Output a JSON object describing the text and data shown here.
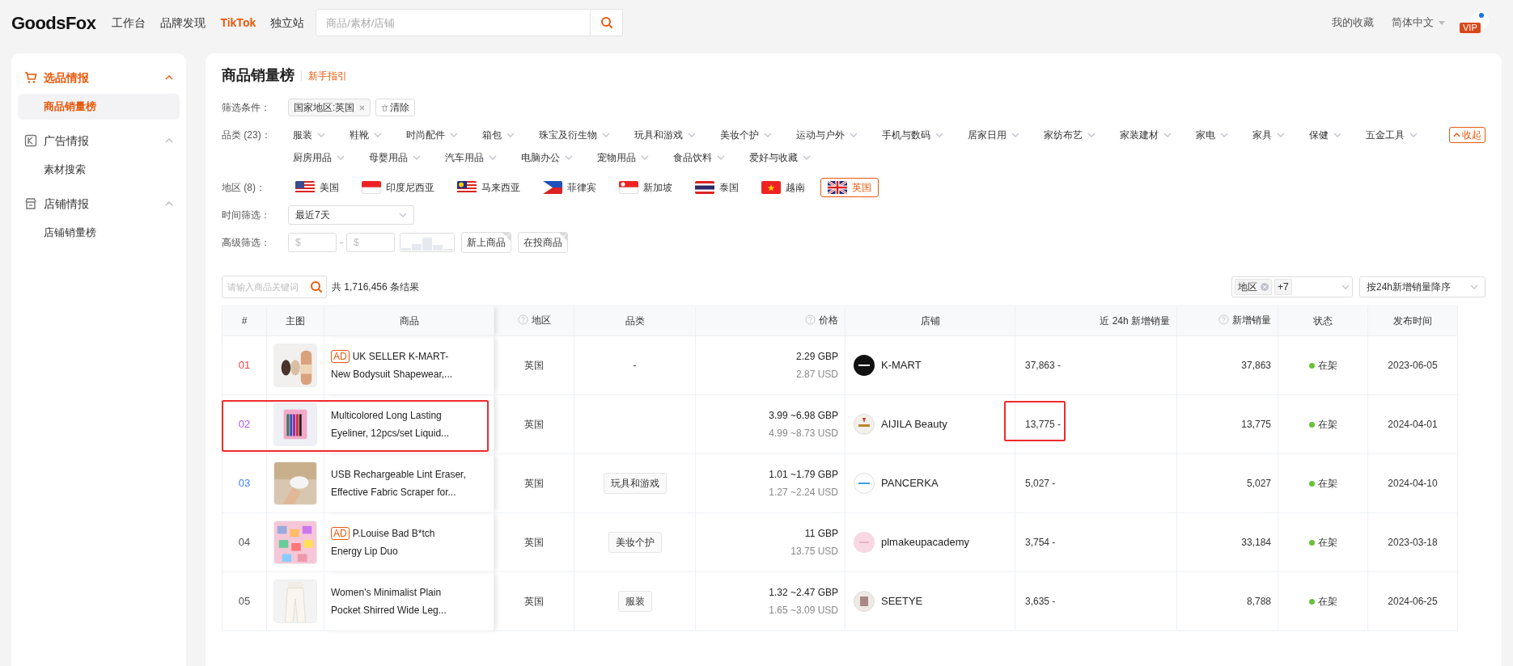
{
  "topbar": {
    "logo": "GoodsFox",
    "nav": [
      {
        "label": "工作台",
        "selected": false
      },
      {
        "label": "品牌发现",
        "selected": false
      },
      {
        "label": "TikTok",
        "selected": true
      },
      {
        "label": "独立站",
        "selected": false
      }
    ],
    "search": {
      "placeholder": "商品/素材/店铺"
    },
    "favorites": "我的收藏",
    "language": "简体中文",
    "vip": "VIP"
  },
  "sidebar": {
    "groups": [
      {
        "label": "选品情报",
        "active": true,
        "items": [
          {
            "label": "商品销量榜",
            "selected": true
          }
        ]
      },
      {
        "label": "广告情报",
        "active": false,
        "items": [
          {
            "label": "素材搜索",
            "selected": false
          }
        ]
      },
      {
        "label": "店铺情报",
        "active": false,
        "items": [
          {
            "label": "店铺销量榜",
            "selected": false
          }
        ]
      }
    ]
  },
  "page": {
    "title": "商品销量榜",
    "guide_link": "新手指引"
  },
  "filters": {
    "conditions_label": "筛选条件：",
    "conditions": [
      "国家地区:英国"
    ],
    "clear": "清除",
    "category_label": "品类 (23)：",
    "categories": [
      [
        "服装",
        "鞋靴",
        "时尚配件",
        "箱包",
        "珠宝及衍生物",
        "玩具和游戏",
        "美妆个护",
        "运动与户外",
        "手机与数码",
        "居家日用",
        "家纺布艺",
        "家装建材",
        "家电",
        "家具",
        "保健",
        "五金工具"
      ],
      [
        "厨房用品",
        "母婴用品",
        "汽车用品",
        "电脑办公",
        "宠物用品",
        "食品饮料",
        "爱好与收藏"
      ]
    ],
    "collapse": "收起",
    "region_label": "地区 (8)：",
    "regions": [
      {
        "label": "美国",
        "selected": false
      },
      {
        "label": "印度尼西亚",
        "selected": false
      },
      {
        "label": "马来西亚",
        "selected": false
      },
      {
        "label": "菲律宾",
        "selected": false
      },
      {
        "label": "新加坡",
        "selected": false
      },
      {
        "label": "泰国",
        "selected": false
      },
      {
        "label": "越南",
        "selected": false
      },
      {
        "label": "英国",
        "selected": true
      }
    ],
    "time_label": "时间筛选：",
    "time_value": "最近7天",
    "advanced_label": "高级筛选：",
    "price_min_placeholder": "$",
    "price_max_placeholder": "$",
    "toggles": [
      "新上商品",
      "在投商品"
    ]
  },
  "results": {
    "search_placeholder": "请输入商品关键词",
    "count": "共 1,716,456 条结果",
    "region_tag": "地区",
    "region_more": "+7",
    "sort": "按24h新增销量降序"
  },
  "table": {
    "columns": [
      {
        "label": "#",
        "help": false
      },
      {
        "label": "主图",
        "help": false
      },
      {
        "label": "商品",
        "help": false
      },
      {
        "label": "地区",
        "help": true
      },
      {
        "label": "品类",
        "help": false
      },
      {
        "label": "价格",
        "help": true
      },
      {
        "label": "店铺",
        "help": false
      },
      {
        "label": "近 24h 新增销量",
        "help": false
      },
      {
        "label": "新增销量",
        "help": true
      },
      {
        "label": "状态",
        "help": false
      },
      {
        "label": "发布时间",
        "help": false
      }
    ],
    "rows": [
      {
        "rank": "01",
        "ad": true,
        "ad_label": "AD",
        "name": [
          "UK SELLER K-MART-",
          "New Bodysuit Shapewear,..."
        ],
        "region": "英国",
        "category": "-",
        "kind": "text",
        "price_gbp": "2.29 GBP",
        "price_usd": "2.87 USD",
        "store": "K-MART",
        "sales_24h": "37,863 -",
        "sales": "37,863",
        "status": "在架",
        "published": "2023-06-05",
        "highlight": false
      },
      {
        "rank": "02",
        "ad": false,
        "name": [
          "Multicolored Long Lasting",
          "Eyeliner, 12pcs/set Liquid..."
        ],
        "region": "英国",
        "price_gbp": "3.99 ~6.98 GBP",
        "price_usd": "4.99 ~8.73 USD",
        "store": "AIJILA Beauty",
        "sales_24h": "13,775 -",
        "sales": "13,775",
        "status": "在架",
        "published": "2024-04-01",
        "highlight": true
      },
      {
        "rank": "03",
        "ad": false,
        "name": [
          "USB Rechargeable Lint Eraser,",
          "Effective Fabric Scraper for..."
        ],
        "region": "英国",
        "category": "玩具和游戏",
        "kind": "tag",
        "price_gbp": "1.01 ~1.79 GBP",
        "price_usd": "1.27 ~2.24 USD",
        "store": "PANCERKA",
        "sales_24h": "5,027 -",
        "sales": "5,027",
        "status": "在架",
        "published": "2024-04-10",
        "highlight": false
      },
      {
        "rank": "04",
        "ad": true,
        "ad_label": "AD",
        "name": [
          "P.Louise Bad B*tch",
          "Energy Lip Duo"
        ],
        "region": "英国",
        "category": "美妆个护",
        "kind": "tag",
        "price_gbp": "11 GBP",
        "price_usd": "13.75 USD",
        "store": "plmakeupacademy",
        "sales_24h": "3,754 -",
        "sales": "33,184",
        "status": "在架",
        "published": "2023-03-18",
        "highlight": false
      },
      {
        "rank": "05",
        "ad": false,
        "name": [
          "Women's Minimalist Plain",
          "Pocket Shirred Wide Leg..."
        ],
        "region": "英国",
        "category": "服装",
        "kind": "tag",
        "price_gbp": "1.32 ~2.47 GBP",
        "price_usd": "1.65 ~3.09 USD",
        "store": "SEETYE",
        "sales_24h": "3,635 -",
        "sales": "8,788",
        "status": "在架",
        "published": "2024-06-25",
        "highlight": false
      }
    ]
  }
}
